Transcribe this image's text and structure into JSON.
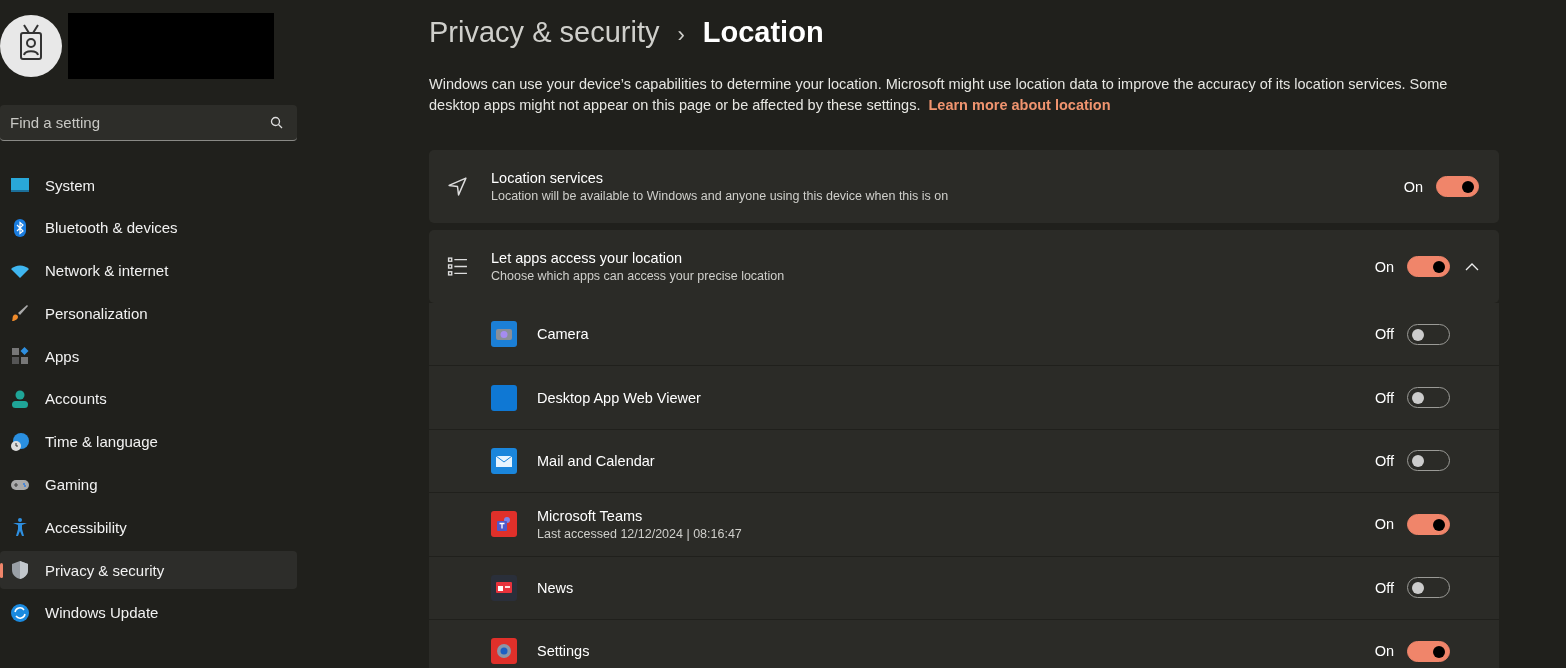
{
  "sidebar": {
    "search": {
      "placeholder": "Find a setting"
    },
    "items": [
      {
        "label": "System",
        "selected": false
      },
      {
        "label": "Bluetooth & devices",
        "selected": false
      },
      {
        "label": "Network & internet",
        "selected": false
      },
      {
        "label": "Personalization",
        "selected": false
      },
      {
        "label": "Apps",
        "selected": false
      },
      {
        "label": "Accounts",
        "selected": false
      },
      {
        "label": "Time & language",
        "selected": false
      },
      {
        "label": "Gaming",
        "selected": false
      },
      {
        "label": "Accessibility",
        "selected": false
      },
      {
        "label": "Privacy & security",
        "selected": true
      },
      {
        "label": "Windows Update",
        "selected": false
      }
    ]
  },
  "breadcrumb": {
    "parent": "Privacy & security",
    "separator": "›",
    "current": "Location"
  },
  "description": {
    "text": "Windows can use your device’s capabilities to determine your location. Microsoft might use location data to improve the accuracy of its location services. Some desktop apps might not appear on this page or be affected by these settings.",
    "link": "Learn more about location"
  },
  "cards": [
    {
      "title": "Location services",
      "subtitle": "Location will be available to Windows and anyone using this device when this is on",
      "status": "On",
      "on": true
    },
    {
      "title": "Let apps access your location",
      "subtitle": "Choose which apps can access your precise location",
      "status": "On",
      "on": true,
      "expanded": true
    }
  ],
  "apps": [
    {
      "name": "Camera",
      "status": "Off",
      "on": false
    },
    {
      "name": "Desktop App Web Viewer",
      "status": "Off",
      "on": false
    },
    {
      "name": "Mail and Calendar",
      "status": "Off",
      "on": false
    },
    {
      "name": "Microsoft Teams",
      "detail": "Last accessed 12/12/2024  |  08:16:47",
      "status": "On",
      "on": true
    },
    {
      "name": "News",
      "status": "Off",
      "on": false
    },
    {
      "name": "Settings",
      "status": "On",
      "on": true
    }
  ]
}
